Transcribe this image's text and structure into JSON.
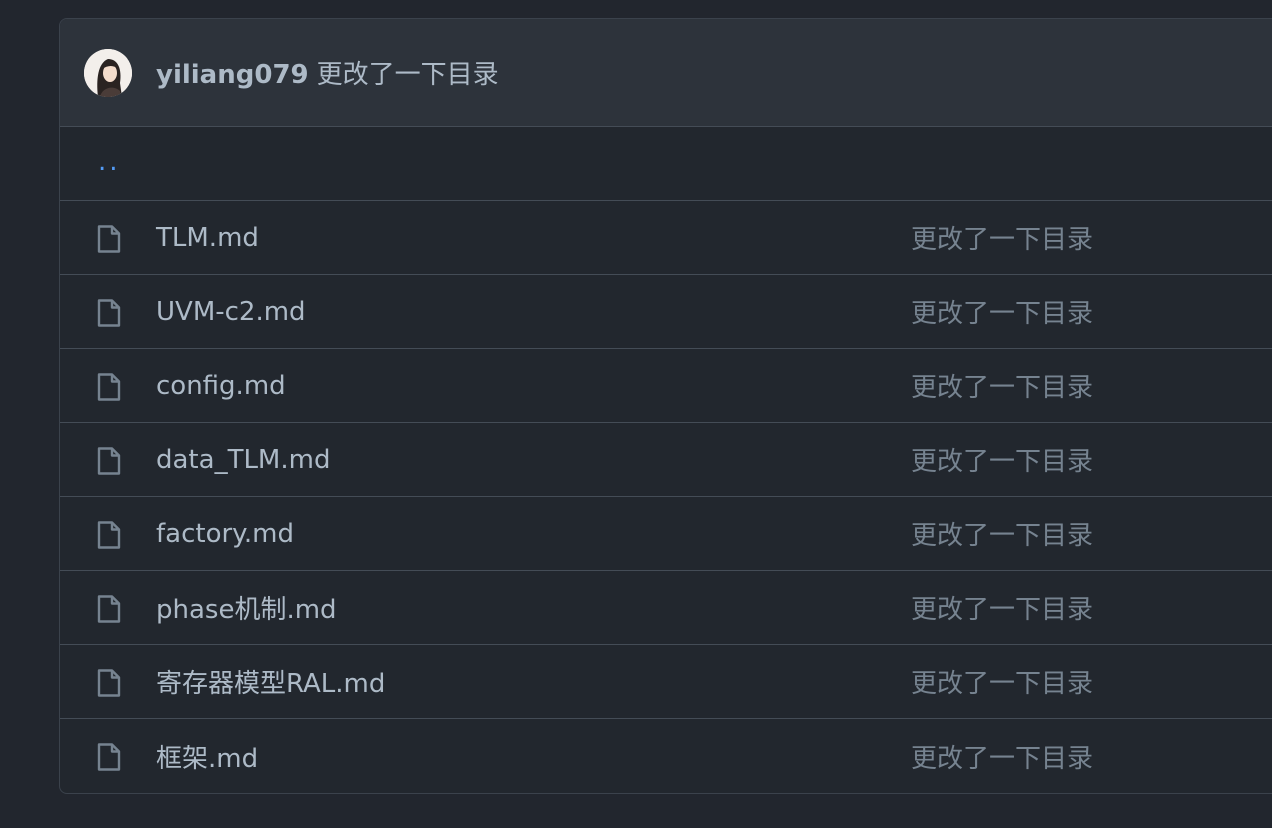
{
  "commit": {
    "author": "yiliang079",
    "message": "更改了一下目录"
  },
  "parent_link": "..",
  "files": [
    {
      "name": "TLM.md",
      "message": "更改了一下目录",
      "icon": "file-icon"
    },
    {
      "name": "UVM-c2.md",
      "message": "更改了一下目录",
      "icon": "file-icon"
    },
    {
      "name": "config.md",
      "message": "更改了一下目录",
      "icon": "file-icon"
    },
    {
      "name": "data_TLM.md",
      "message": "更改了一下目录",
      "icon": "file-icon"
    },
    {
      "name": "factory.md",
      "message": "更改了一下目录",
      "icon": "file-icon"
    },
    {
      "name": "phase机制.md",
      "message": "更改了一下目录",
      "icon": "file-icon"
    },
    {
      "name": "寄存器模型RAL.md",
      "message": "更改了一下目录",
      "icon": "file-icon"
    },
    {
      "name": "框架.md",
      "message": "更改了一下目录",
      "icon": "file-icon"
    }
  ],
  "colors": {
    "background": "#22272e",
    "header": "#2d333b",
    "border": "#444c56",
    "text": "#adbac7",
    "muted": "#768390",
    "link": "#539bf5"
  }
}
